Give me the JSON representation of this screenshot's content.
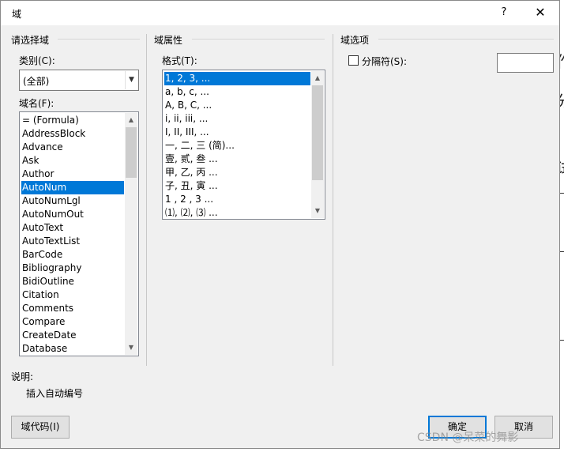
{
  "window": {
    "title": "域",
    "help_glyph": "?",
    "close_glyph": "✕"
  },
  "left_panel": {
    "section_title": "请选择域",
    "category_label": "类别(C):",
    "category_value": "(全部)",
    "field_names_label": "域名(F):",
    "field_names": [
      "= (Formula)",
      "AddressBlock",
      "Advance",
      "Ask",
      "Author",
      "AutoNum",
      "AutoNumLgl",
      "AutoNumOut",
      "AutoText",
      "AutoTextList",
      "BarCode",
      "Bibliography",
      "BidiOutline",
      "Citation",
      "Comments",
      "Compare",
      "CreateDate",
      "Database"
    ],
    "selected_field": "AutoNum"
  },
  "middle_panel": {
    "section_title": "域属性",
    "format_label": "格式(T):",
    "formats": [
      "1, 2, 3, ...",
      "a, b, c, ...",
      "A, B, C, ...",
      "i, ii, iii, ...",
      "I, II, III, ...",
      "一, 二, 三 (简)...",
      "壹, 贰, 叁 ...",
      "甲, 乙, 丙 ...",
      "子, 丑, 寅 ...",
      "1 , 2 , 3  ...",
      "⑴, ⑵, ⑶ ..."
    ],
    "selected_format": "1, 2, 3, ..."
  },
  "right_panel": {
    "section_title": "域选项",
    "separator_checkbox_label": "分隔符(S):",
    "separator_checked": false,
    "separator_value": ""
  },
  "description": {
    "label": "说明:",
    "text": "插入自动编号"
  },
  "buttons": {
    "field_codes": "域代码(I)",
    "ok": "确定",
    "cancel": "取消"
  },
  "watermark": "CSDN @呆菜的舞影",
  "background_doc": {
    "glyphs": [
      "作",
      "分",
      "试"
    ]
  },
  "colors": {
    "selection": "#0078d7",
    "dialog_bg": "#f0f0f0"
  }
}
